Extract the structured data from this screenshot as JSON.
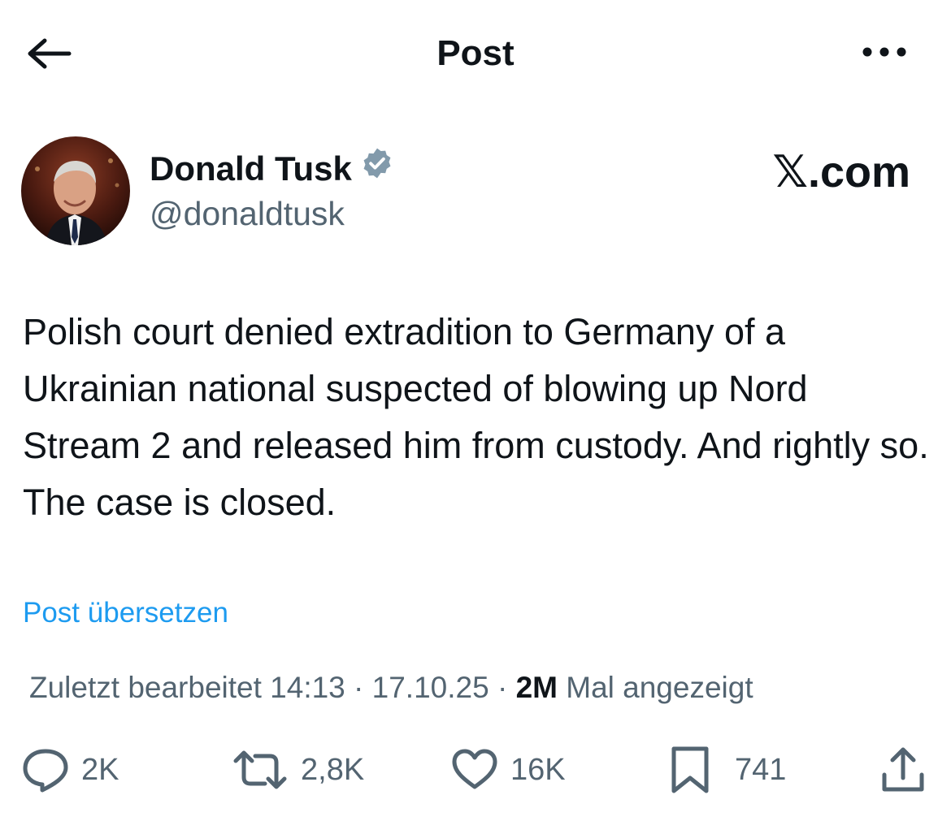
{
  "header": {
    "title": "Post",
    "back_icon": "arrow-left-icon",
    "more_icon": "more-horizontal-icon"
  },
  "author": {
    "name": "Donald Tusk",
    "handle": "@donaldtusk",
    "verified": true,
    "verified_color": "#1d9bf0"
  },
  "brand": {
    "x_glyph": "𝕏",
    "domain": ".com"
  },
  "post": {
    "text": "Polish court denied extradition to Germany of a Ukrainian national suspected of blowing up Nord Stream 2 and released him from custody. And rightly so. The case is closed.",
    "translate_label": "Post übersetzen"
  },
  "meta": {
    "edited_label": "Zuletzt bearbeitet 14:13 · 17.10.25",
    "separator": " · ",
    "views_count": "2M",
    "views_label": " Mal angezeigt"
  },
  "actions": {
    "replies": {
      "icon": "reply-icon",
      "count": "2K"
    },
    "reposts": {
      "icon": "repost-icon",
      "count": "2,8K"
    },
    "likes": {
      "icon": "heart-icon",
      "count": "16K"
    },
    "bookmarks": {
      "icon": "bookmark-icon",
      "count": "741"
    },
    "share": {
      "icon": "share-icon"
    }
  },
  "colors": {
    "text": "#0f1419",
    "secondary": "#536471",
    "accent": "#1d9bf0"
  }
}
